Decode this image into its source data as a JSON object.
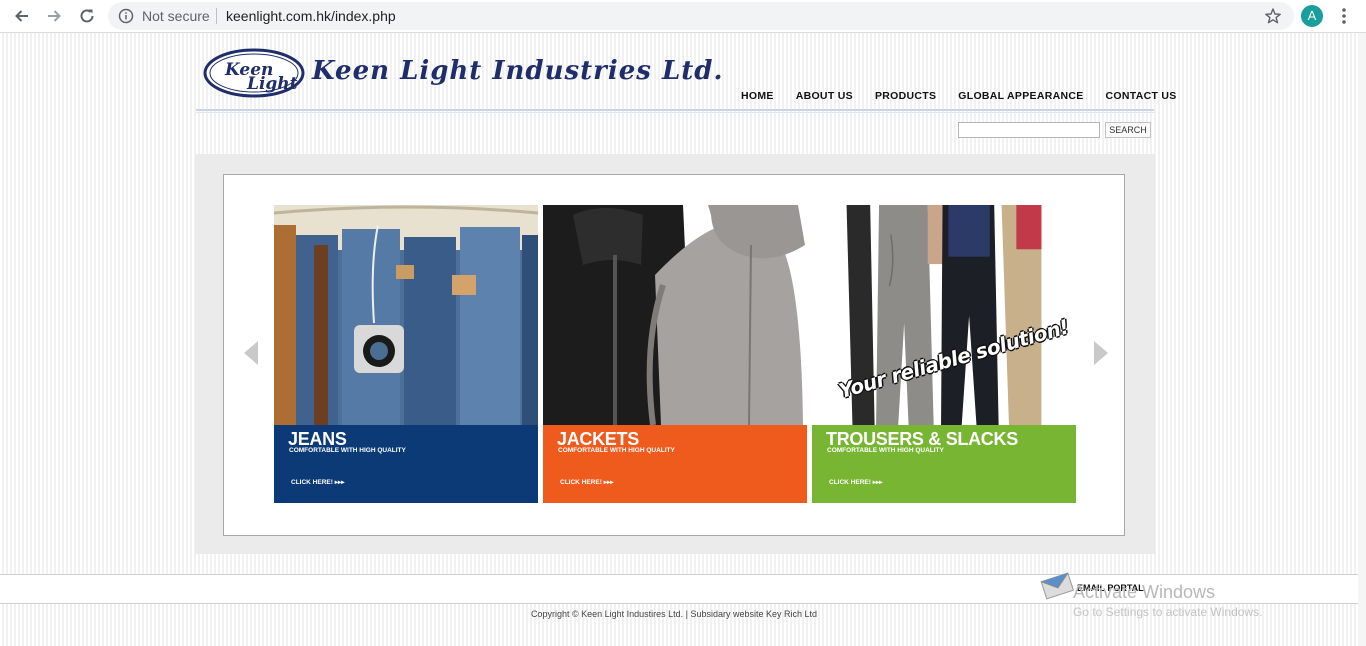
{
  "browser": {
    "security_label": "Not secure",
    "url": "keenlight.com.hk/index.php",
    "profile_initial": "A"
  },
  "site": {
    "company_name": "Keen Light Industries Ltd.",
    "logo_text": "Keen Light",
    "nav": [
      "HOME",
      "ABOUT US",
      "PRODUCTS",
      "GLOBAL APPEARANCE",
      "CONTACT US"
    ],
    "search": {
      "value": "",
      "button": "SEARCH"
    }
  },
  "slider": {
    "tiles": [
      {
        "title": "JEANS",
        "subtitle": "COMFORTABLE WITH HIGH QUALITY",
        "cta": "CLICK HERE! ▸▸▸",
        "color": "#0c3a77"
      },
      {
        "title": "JACKETS",
        "subtitle": "COMFORTABLE WITH HIGH QUALITY",
        "cta": "CLICK HERE! ▸▸▸",
        "color": "#ef5b1d"
      },
      {
        "title": "TROUSERS & SLACKS",
        "subtitle": "COMFORTABLE WITH HIGH QUALITY",
        "cta": "CLICK HERE! ▸▸▸",
        "color": "#6baf21"
      }
    ],
    "tagline": "Your reliable solution!"
  },
  "footer": {
    "email_portal": "EMAIL PORTAL",
    "copyright": "Copyright © Keen Light Industires Ltd. | Subsidary website Key Rich Ltd"
  },
  "os_overlay": {
    "title": "Activate Windows",
    "subtitle": "Go to Settings to activate Windows."
  }
}
